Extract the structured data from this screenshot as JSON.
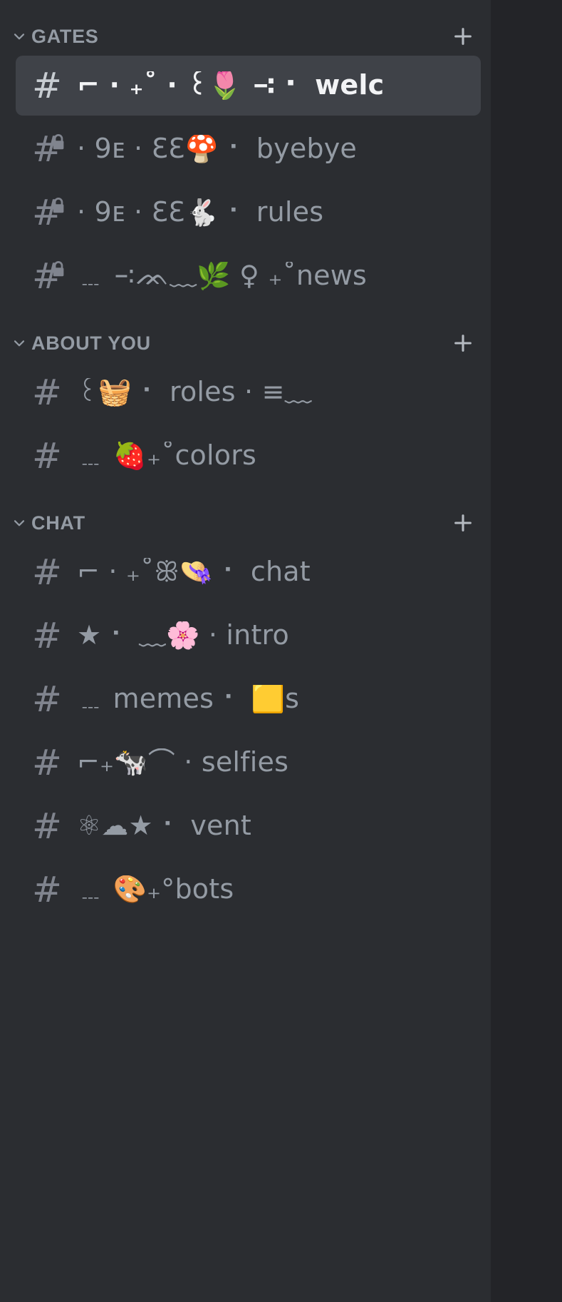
{
  "app": "discord-channel-sidebar",
  "theme": {
    "sidebar_bg": "#2b2d31",
    "active_row_bg": "#3f4248",
    "channel_text": "#949ba4",
    "active_channel_text": "#f2f3f5",
    "category_text": "#949ba4",
    "hash_icon": "#80848e"
  },
  "categories": [
    {
      "id": "gates",
      "label": "GATES",
      "chevron_icon": "chevron-down-icon",
      "add_icon": "plus-icon",
      "add_label": "+",
      "collapsed": false,
      "channels": [
        {
          "id": "welc",
          "name": "⌐ · ₊˚ · ꒰🌷 ∹ ⠂ welc",
          "deco_left": "⌐ · ₊˚ · ꒰",
          "emoji": "🌷",
          "deco_right": " ∹ ⠂ ",
          "label": "welc",
          "icon": "hash-icon",
          "locked": false,
          "active": true
        },
        {
          "id": "byebye",
          "name": "· 𝟫ᴇ · ƐƐ🍄 ⠂ byebye",
          "deco_left": "· 𝟫ᴇ · ƐƐ",
          "emoji": "🍄",
          "deco_right": " ⠂ ",
          "label": "byebye",
          "icon": "hash-locked-icon",
          "locked": true,
          "active": false
        },
        {
          "id": "rules",
          "name": "· 𝟫ᴇ · ƐƐ🐇 ⠂ rules",
          "deco_left": "· 𝟫ᴇ · ƐƐ",
          "emoji": "🐇",
          "deco_right": " ⠂ ",
          "label": "rules",
          "icon": "hash-locked-icon",
          "locked": true,
          "active": false
        },
        {
          "id": "news",
          "name": "﹍ ∹ᨏ﹏🌿 ♀ ₊˚news",
          "deco_left": "﹍ ∹ᨏ﹏",
          "emoji": "🌿",
          "deco_right": " ♀ ₊˚",
          "label": "news",
          "icon": "hash-locked-icon",
          "locked": true,
          "active": false
        }
      ]
    },
    {
      "id": "about-you",
      "label": "ABOUT YOU",
      "chevron_icon": "chevron-down-icon",
      "add_icon": "plus-icon",
      "add_label": "+",
      "collapsed": false,
      "channels": [
        {
          "id": "roles",
          "name": "꒰🧺 ⠂ roles · ≡﹏",
          "deco_left": "꒰",
          "emoji": "🧺",
          "deco_right": " ⠂ ",
          "label": "roles",
          "deco_tail": " · ≡ ﹨",
          "icon": "hash-icon",
          "locked": false,
          "active": false
        },
        {
          "id": "colors",
          "name": "﹍ 🍓₊˚colors",
          "deco_left": "﹍ ",
          "emoji": "🍓",
          "deco_right": "₊˚",
          "label": "colors",
          "icon": "hash-icon",
          "locked": false,
          "active": false
        }
      ]
    },
    {
      "id": "chat",
      "label": "CHAT",
      "chevron_icon": "chevron-down-icon",
      "add_icon": "plus-icon",
      "add_label": "+",
      "collapsed": false,
      "channels": [
        {
          "id": "chat",
          "name": "⌐ · ₊˚ꕥ👒 ⠂ chat",
          "deco_left": "⌐ · ₊˚ꕥ",
          "emoji": "👒",
          "deco_right": " ⠂ ",
          "label": "chat",
          "icon": "hash-icon",
          "locked": false,
          "active": false
        },
        {
          "id": "intro",
          "name": "★ ⠂ ﹏🌸 · intro",
          "deco_left": "★ ⠂ ﹏",
          "emoji": "🌸",
          "deco_right": " · ",
          "label": "intro",
          "icon": "hash-icon",
          "locked": false,
          "active": false
        },
        {
          "id": "memes",
          "name": "﹍ memes ⠂ 🟨ꜱ",
          "deco_left": "﹍ ",
          "emoji": "",
          "deco_right": "",
          "label": "memes",
          "deco_tail": " ⠂ 🟨 ؍",
          "icon": "hash-icon",
          "locked": false,
          "active": false
        },
        {
          "id": "selfies",
          "name": "⌐₊🐄⌒ · selfies",
          "deco_left": "⌐₊",
          "emoji": "🐄",
          "deco_right": "⌒ · ",
          "label": "selfies",
          "icon": "hash-icon",
          "locked": false,
          "active": false
        },
        {
          "id": "vent",
          "name": "⚛☁★ ⠂ vent",
          "deco_left": "⚛",
          "emoji": "☁️",
          "deco_right": "★ ⠂ ",
          "label": "vent",
          "icon": "hash-icon",
          "locked": false,
          "active": false
        },
        {
          "id": "bots",
          "name": "﹍ 🎨₊°bots",
          "deco_left": "﹍ ",
          "emoji": "🎨",
          "deco_right": "₊°",
          "label": "bots",
          "icon": "hash-icon",
          "locked": false,
          "active": false
        }
      ]
    }
  ]
}
